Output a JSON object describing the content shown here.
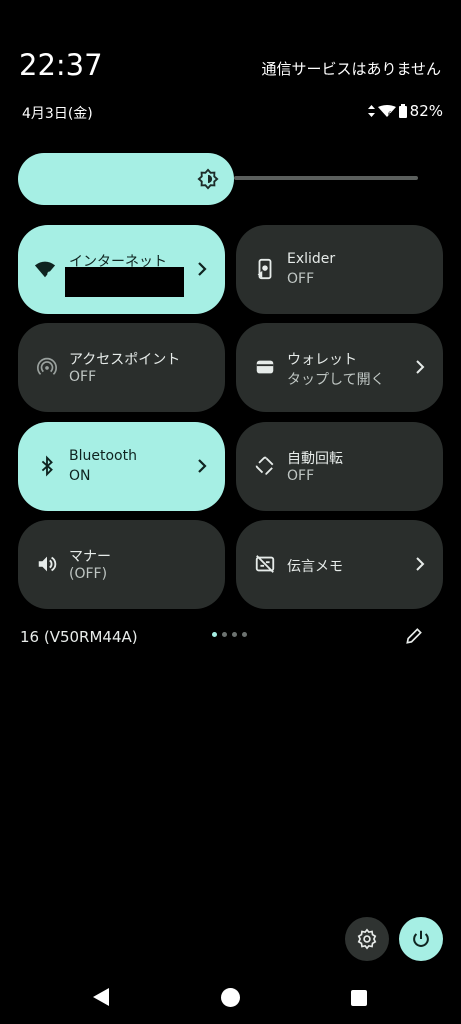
{
  "status_bar": {
    "time": "22:37",
    "carrier": "通信サービスはありません",
    "date": "4月3日(金)",
    "battery": "82%"
  },
  "brightness": {
    "level": 0.54
  },
  "tiles": [
    {
      "id": "internet",
      "label": "インターネット",
      "sub": "",
      "state": "on",
      "chevron": true,
      "icon": "wifi-icon"
    },
    {
      "id": "exlider",
      "label": "Exlider",
      "sub": "OFF",
      "state": "off",
      "chevron": false,
      "icon": "exlider-icon"
    },
    {
      "id": "hotspot",
      "label": "アクセスポイント",
      "sub": "OFF",
      "state": "off",
      "chevron": false,
      "icon": "hotspot-icon"
    },
    {
      "id": "wallet",
      "label": "ウォレット",
      "sub": "タップして開く",
      "state": "off",
      "chevron": true,
      "icon": "wallet-icon"
    },
    {
      "id": "bluetooth",
      "label": "Bluetooth",
      "sub": "ON",
      "state": "on",
      "chevron": true,
      "icon": "bluetooth-icon"
    },
    {
      "id": "autorotate",
      "label": "自動回転",
      "sub": "OFF",
      "state": "off",
      "chevron": false,
      "icon": "rotate-icon"
    },
    {
      "id": "manner",
      "label": "マナー",
      "sub": "(OFF)",
      "state": "off",
      "chevron": false,
      "icon": "speaker-icon"
    },
    {
      "id": "voicememo",
      "label": "伝言メモ",
      "sub": "",
      "state": "off",
      "chevron": true,
      "icon": "voicemail-icon"
    }
  ],
  "footer": {
    "build": "16 (V50RM44A)",
    "page_count": 4,
    "active_page": 1
  },
  "colors": {
    "accent": "#a6efe4",
    "tile_off": "#2a2e2c",
    "background": "#000000"
  }
}
